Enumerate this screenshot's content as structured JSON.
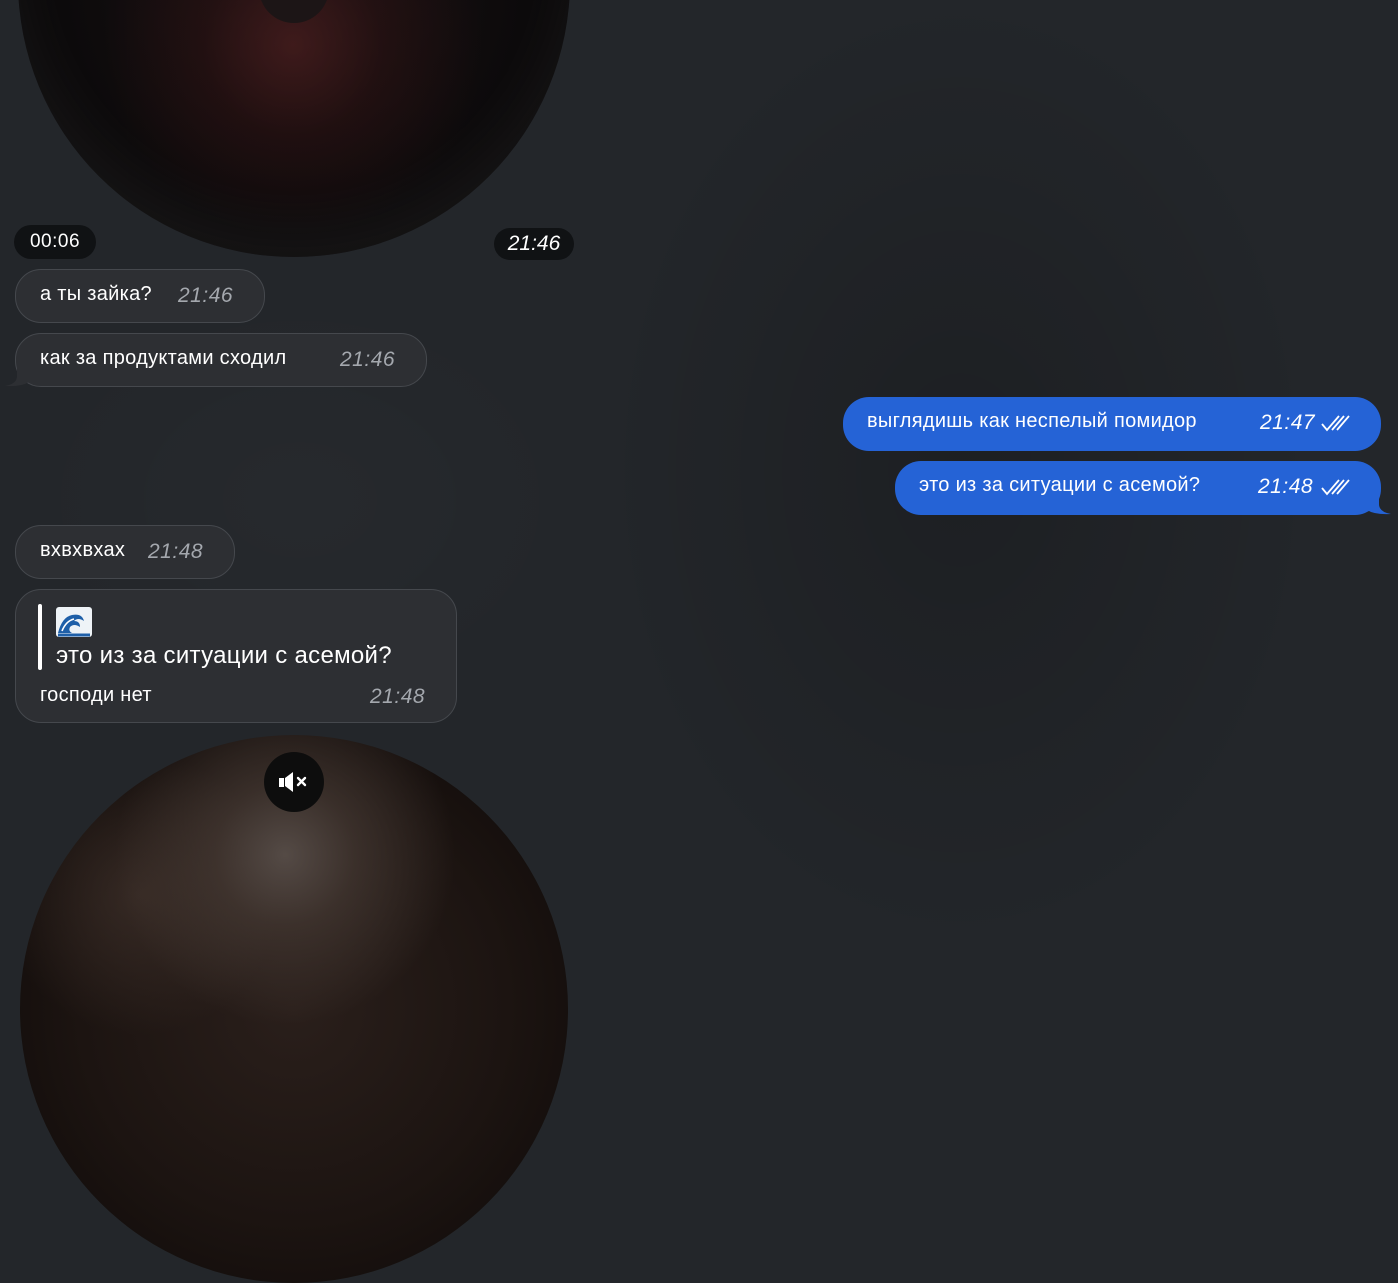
{
  "video_top": {
    "duration": "00:06",
    "time": "21:46"
  },
  "messages": [
    {
      "text": "а ты зайка?",
      "time": "21:46",
      "direction": "incoming"
    },
    {
      "text": "как за продуктами сходил",
      "time": "21:46",
      "direction": "incoming"
    },
    {
      "text": "выглядишь как неспелый помидор",
      "time": "21:47",
      "direction": "outgoing",
      "status": "read"
    },
    {
      "text": "это из за ситуации с асемой?",
      "time": "21:48",
      "direction": "outgoing",
      "status": "read"
    },
    {
      "text": "вхвхвхах",
      "time": "21:48",
      "direction": "incoming"
    }
  ],
  "reply_message": {
    "quoted_emoji": "wave-emoji-icon",
    "quoted_text": "это из за ситуации с асемой?",
    "text": "господи нет",
    "time": "21:48"
  },
  "video_bottom": {
    "mute_icon": "speaker-muted-icon"
  },
  "colors": {
    "background": "#23262a",
    "incoming_bubble": "#2d2f33",
    "outgoing_bubble": "#2563d6",
    "time_incoming": "#a4a8ae"
  }
}
